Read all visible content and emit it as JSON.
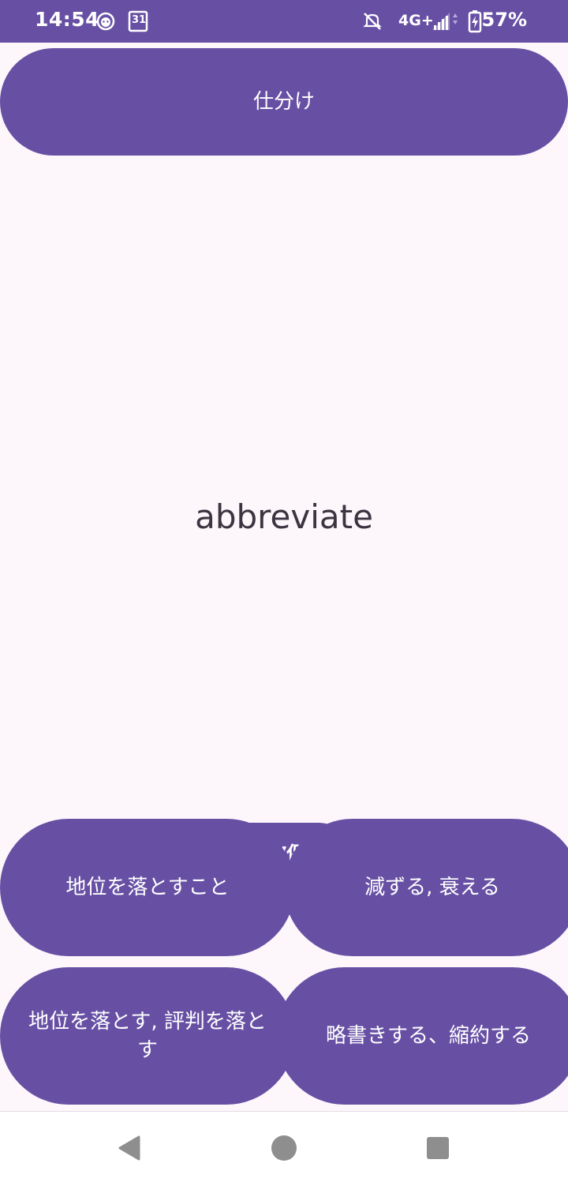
{
  "status_bar": {
    "time": "14:54",
    "calendar_day": "31",
    "network": "4G+",
    "battery": "57%",
    "icons": [
      "face-notification-icon",
      "calendar-icon",
      "mute-icon",
      "signal-icon",
      "battery-charging-icon"
    ]
  },
  "top_button": {
    "label": "仕分け"
  },
  "word": {
    "text": "abbreviate"
  },
  "csv_button": {
    "label": "CSV保存"
  },
  "options": [
    {
      "label": "地位を落とすこと"
    },
    {
      "label": "減ずる, 衰える"
    },
    {
      "label": "地位を落とす, 評判を落とす"
    },
    {
      "label": "略書きする、縮約する"
    }
  ],
  "nav_bar": {
    "icons": [
      "back-icon",
      "home-icon",
      "recents-icon"
    ]
  },
  "colors": {
    "accent": "#6750a4",
    "background": "#fdf7fc",
    "text": "#3a3540"
  }
}
